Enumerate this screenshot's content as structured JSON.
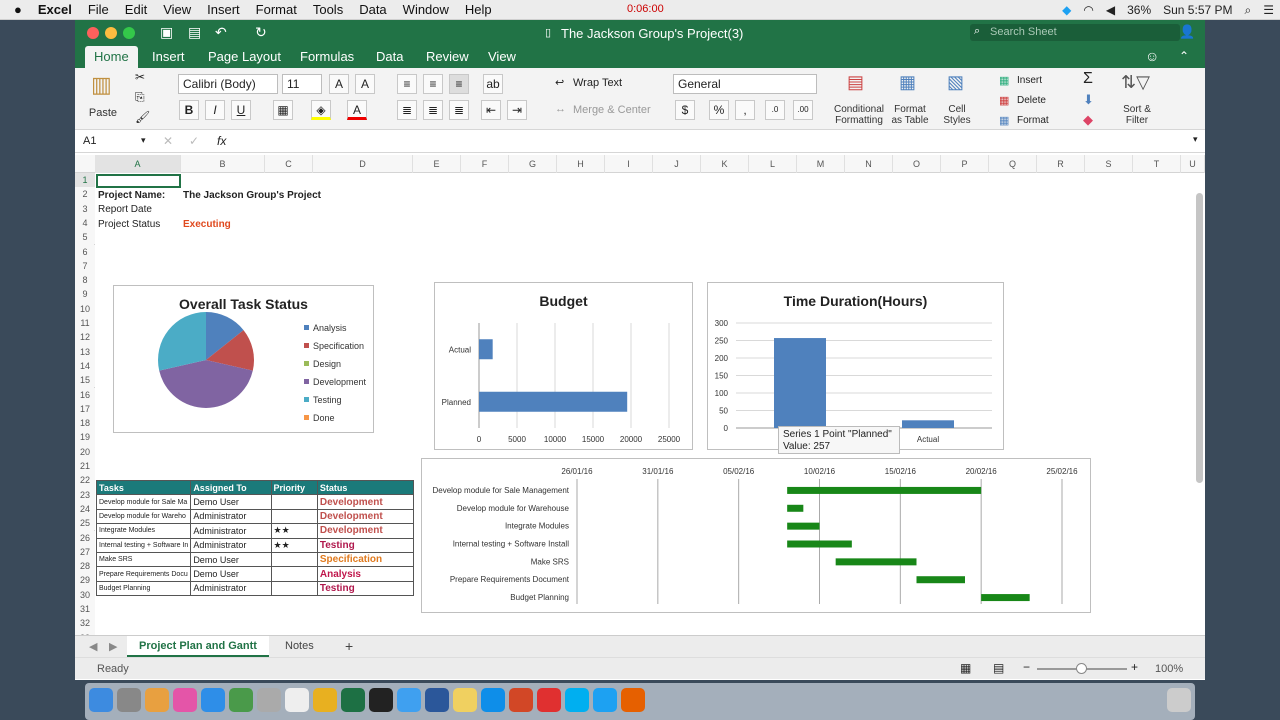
{
  "menubar": {
    "app": "Excel",
    "items": [
      "File",
      "Edit",
      "View",
      "Insert",
      "Format",
      "Tools",
      "Data",
      "Window",
      "Help"
    ],
    "timer": "0:06:00",
    "battery": "36%",
    "clock": "Sun 5:57 PM"
  },
  "window": {
    "title": "The Jackson Group's Project(3)",
    "search_placeholder": "Search Sheet"
  },
  "ribbon": {
    "tabs": [
      "Home",
      "Insert",
      "Page Layout",
      "Formulas",
      "Data",
      "Review",
      "View"
    ],
    "paste": "Paste",
    "font_name": "Calibri (Body)",
    "font_size": "11",
    "wrap_text": "Wrap Text",
    "merge_center": "Merge & Center",
    "number_format": "General",
    "conditional": "Conditional\nFormatting",
    "format_table": "Format\nas Table",
    "cell_styles": "Cell\nStyles",
    "insert": "Insert",
    "delete": "Delete",
    "format": "Format",
    "sort_filter": "Sort &\nFilter"
  },
  "formula": {
    "name_box": "A1",
    "fx": "fx",
    "value": ""
  },
  "columns": [
    "A",
    "B",
    "C",
    "D",
    "E",
    "F",
    "G",
    "H",
    "I",
    "J",
    "K",
    "L",
    "M",
    "N",
    "O",
    "P",
    "Q",
    "R",
    "S",
    "T",
    "U"
  ],
  "rows": [
    "1",
    "2",
    "3",
    "4",
    "5",
    "6",
    "7",
    "8",
    "9",
    "10",
    "11",
    "12",
    "13",
    "14",
    "15",
    "16",
    "17",
    "18",
    "19",
    "20",
    "21",
    "22",
    "23",
    "24",
    "25",
    "26",
    "27",
    "28",
    "29",
    "30",
    "31",
    "32",
    "33"
  ],
  "cells": {
    "project_name_label": "Project Name:",
    "project_name": "The Jackson Group's Project",
    "report_date_label": "Report Date",
    "status_label": "Project Status",
    "status": "Executing"
  },
  "task_table": {
    "headers": [
      "Tasks",
      "Assigned To",
      "Priority",
      "Status"
    ],
    "rows": [
      [
        "Develop module for Sale Ma",
        "Demo User",
        "",
        "Development"
      ],
      [
        "Develop module for Wareho",
        "Administrator",
        "",
        "Development"
      ],
      [
        "Integrate Modules",
        "Administrator",
        "★★",
        "Development"
      ],
      [
        "Internal testing + Software In",
        "Administrator",
        "★★",
        "Testing"
      ],
      [
        "Make SRS",
        "Demo User",
        "",
        "Specification"
      ],
      [
        "Prepare Requirements Docu",
        "Demo User",
        "",
        "Analysis"
      ],
      [
        "Budget Planning",
        "Administrator",
        "",
        "Testing"
      ]
    ]
  },
  "chart_data": [
    {
      "type": "pie",
      "title": "Overall Task Status",
      "categories": [
        "Analysis",
        "Specification",
        "Design",
        "Development",
        "Testing",
        "Done"
      ],
      "values": [
        1,
        1,
        0,
        3,
        2,
        0
      ],
      "colors": [
        "#4f81bd",
        "#c0504d",
        "#9bbb59",
        "#8064a2",
        "#4bacc6",
        "#f79646"
      ],
      "legend": "right"
    },
    {
      "type": "bar",
      "title": "Budget",
      "orientation": "horizontal",
      "categories": [
        "Planned",
        "Actual"
      ],
      "values": [
        19500,
        1800
      ],
      "xlim": [
        0,
        25000
      ],
      "xticks": [
        "0",
        "5000",
        "10000",
        "15000",
        "20000",
        "25000"
      ],
      "color": "#4f81bd"
    },
    {
      "type": "bar",
      "title": "Time Duration(Hours)",
      "categories": [
        "Planned",
        "Actual"
      ],
      "values": [
        257,
        22
      ],
      "ylim": [
        0,
        300
      ],
      "yticks": [
        "0",
        "50",
        "100",
        "150",
        "200",
        "250",
        "300"
      ],
      "color": "#4f81bd",
      "tooltip": {
        "line1": "Series 1 Point \"Planned\"",
        "line2": "Value: 257"
      }
    },
    {
      "type": "gantt",
      "dates": [
        "26/01/16",
        "31/01/16",
        "05/02/16",
        "10/02/16",
        "15/02/16",
        "20/02/16",
        "25/02/16"
      ],
      "tasks": [
        {
          "name": "Develop module for Sale Management",
          "start": "08/02/16",
          "end": "20/02/16"
        },
        {
          "name": "Develop module for Warehouse",
          "start": "08/02/16",
          "end": "09/02/16"
        },
        {
          "name": "Integrate Modules",
          "start": "08/02/16",
          "end": "10/02/16"
        },
        {
          "name": "Internal testing + Software Install",
          "start": "08/02/16",
          "end": "12/02/16"
        },
        {
          "name": "Make SRS",
          "start": "11/02/16",
          "end": "16/02/16"
        },
        {
          "name": "Prepare Requirements Document",
          "start": "16/02/16",
          "end": "19/02/16"
        },
        {
          "name": "Budget Planning",
          "start": "20/02/16",
          "end": "23/02/16"
        }
      ],
      "color": "#188718"
    }
  ],
  "sheets": {
    "tabs": [
      "Project Plan and Gantt",
      "Notes"
    ],
    "add": "+"
  },
  "status": {
    "ready": "Ready",
    "zoom": "100%"
  }
}
